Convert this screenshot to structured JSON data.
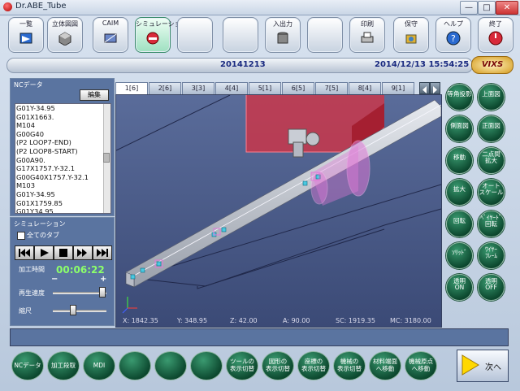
{
  "window": {
    "title": "Dr.ABE_Tube",
    "minimize": "—",
    "maximize": "□",
    "close": "✕"
  },
  "toolbar": [
    {
      "label": "一覧",
      "icon": "list-icon",
      "active": false
    },
    {
      "label": "立体図図",
      "icon": "solid-view-icon",
      "active": false
    },
    {
      "label": "CAIM",
      "icon": "caim-icon",
      "active": false
    },
    {
      "label": "シミュレーション",
      "icon": "simulation-icon",
      "active": true
    },
    {
      "label": "",
      "icon": "",
      "active": false
    },
    {
      "label": "",
      "icon": "",
      "active": false
    },
    {
      "label": "入出力",
      "icon": "database-icon",
      "active": false
    },
    {
      "label": "",
      "icon": "",
      "active": false
    },
    {
      "label": "印刷",
      "icon": "printer-icon",
      "active": false
    },
    {
      "label": "保守",
      "icon": "maintenance-icon",
      "active": false
    },
    {
      "label": "ヘルプ",
      "icon": "help-icon",
      "active": false
    },
    {
      "label": "終了",
      "icon": "exit-icon",
      "active": false
    }
  ],
  "datebar": {
    "program": "20141213",
    "datetime": "2014/12/13 15:54:25",
    "logo": "VIXS"
  },
  "nc_panel": {
    "title": "NCデータ",
    "edit_label": "編集",
    "lines": [
      "G01Y-34.95",
      "G01X1663.",
      "M104",
      "G00G40",
      "(P2 LOOP7-END)",
      "(P2 LOOP8-START)",
      "G00A90.",
      "G17X1757.Y-32.1",
      "G00G40X1757.Y-32.1",
      "M103",
      "G01Y-34.95",
      "G01X1759.85",
      "G01Y34.95",
      "G01X1754.15"
    ],
    "selected_index": 13
  },
  "sim_panel": {
    "title": "シミュレーション",
    "all_tools": "全てのタブ",
    "time_label": "加工時間",
    "time_value": "00:06:22",
    "speed_label": "再生速度",
    "zoom_label": "縮尺",
    "minus": "−",
    "plus": "+",
    "speed_level": 0.95,
    "zoom_level": 0.35
  },
  "tabs": [
    "1[6]",
    "2[6]",
    "3[3]",
    "4[4]",
    "5[1]",
    "6[5]",
    "7[5]",
    "8[4]",
    "9[1]"
  ],
  "active_tab": 0,
  "coords": {
    "x": "X: 1842.35",
    "y": "Y: 348.95",
    "z": "Z: 42.00",
    "a": "A: 90.00",
    "sc": "SC: 1919.35",
    "mc": "MC: 3180.00"
  },
  "right_buttons": [
    {
      "label": "等角投影"
    },
    {
      "label": "上面図"
    },
    {
      "label": "側面図"
    },
    {
      "label": "正面図"
    },
    {
      "label": "移動"
    },
    {
      "label": "二点間\n拡大"
    },
    {
      "label": "拡大"
    },
    {
      "label": "オート\nスケール"
    },
    {
      "label": "回転"
    },
    {
      "label": "ﾍﾞｲﾔｰﾄﾞ\n回転"
    },
    {
      "label": "ｿﾘｯﾄﾞ"
    },
    {
      "label": "ﾜｲﾔｰ\nﾌﾚｰﾑ"
    },
    {
      "label": "透明\nON"
    },
    {
      "label": "透明\nOFF"
    }
  ],
  "bottom_buttons": [
    {
      "label": "NCデータ"
    },
    {
      "label": "加工段取"
    },
    {
      "label": "MDI"
    },
    {
      "label": ""
    },
    {
      "label": ""
    },
    {
      "label": ""
    },
    {
      "label": "ツールの\n表示切替"
    },
    {
      "label": "図形の\n表示切替"
    },
    {
      "label": "座標の\n表示切替"
    },
    {
      "label": "機械の\n表示切替"
    },
    {
      "label": "材料端面\nへ移動"
    },
    {
      "label": "機械原点\nへ移動"
    }
  ],
  "next_label": "次へ",
  "colors": {
    "viewport_bg": "#4a5f8f",
    "tube": "#c8ccd4",
    "red_block": "#d83040",
    "pink_ring": "#e07ad8",
    "time_green": "#8cff6a"
  }
}
